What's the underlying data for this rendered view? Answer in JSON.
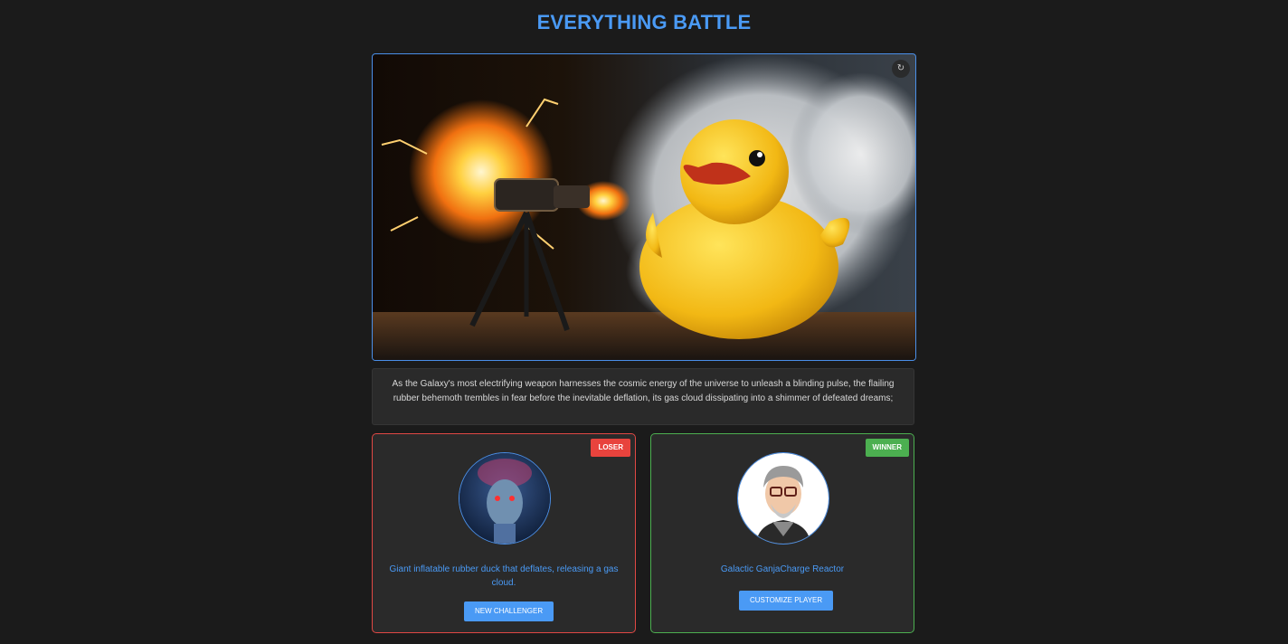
{
  "header": {
    "title": "EVERYTHING BATTLE"
  },
  "hero": {
    "refresh_icon": "refresh-icon",
    "refresh_glyph": "↻"
  },
  "description": "As the Galaxy's most electrifying weapon harnesses the cosmic energy of the universe to unleash a blinding pulse, the flailing rubber behemoth trembles in fear before the inevitable deflation, its gas cloud dissipating into a shimmer of defeated dreams;",
  "loser": {
    "badge": "LOSER",
    "name": "Giant inflatable rubber duck that deflates, releasing a gas cloud.",
    "button": "NEW CHALLENGER"
  },
  "winner": {
    "badge": "WINNER",
    "name": "Galactic GanjaCharge Reactor",
    "button": "CUSTOMIZE PLAYER"
  },
  "colors": {
    "accent": "#4a9af5",
    "loser": "#e8433d",
    "winner": "#4caf50",
    "background": "#1b1b1b",
    "card": "#2a2a2a"
  }
}
